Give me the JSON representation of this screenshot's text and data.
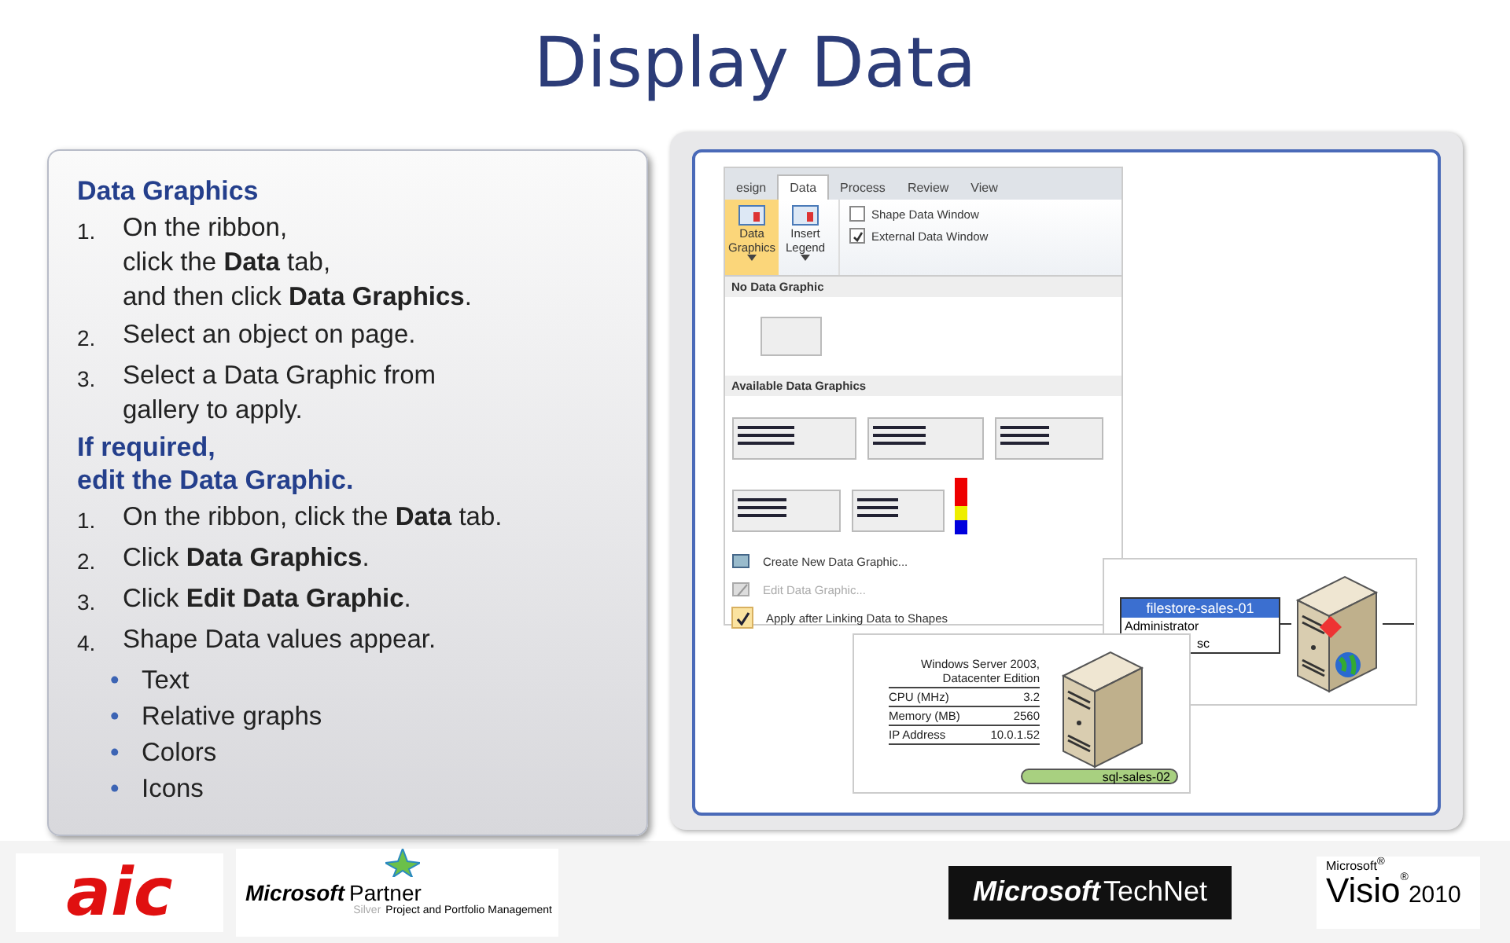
{
  "title": "Display Data",
  "instructions": [
    {
      "heading": "Data Graphics",
      "steps": [
        {
          "num": "1.",
          "text": "On the ribbon,\nclick the **Data** tab,\nand then click **Data Graphics**."
        },
        {
          "num": "2.",
          "text": "Select an object on page."
        },
        {
          "num": "3.",
          "text": "Select a Data Graphic from\ngallery to apply."
        }
      ]
    },
    {
      "heading": "If required,\nedit the Data Graphic.",
      "steps": [
        {
          "num": "1.",
          "text": "On the ribbon, click the **Data** tab."
        },
        {
          "num": "2.",
          "text": "Click **Data Graphics**."
        },
        {
          "num": "3.",
          "text": "Click **Edit Data Graphic**."
        },
        {
          "num": "4.",
          "text": "Shape Data values appear.",
          "bullets": [
            {
              "mark": "•",
              "text": "Text"
            },
            {
              "mark": "•",
              "text": "Relative graphs"
            },
            {
              "mark": "•",
              "text": "Colors"
            },
            {
              "mark": "•",
              "text": "Icons"
            }
          ]
        }
      ]
    }
  ],
  "screenshot": {
    "tabs": [
      {
        "label": "esign",
        "selected": false
      },
      {
        "label": "Data",
        "selected": true
      },
      {
        "label": "Process",
        "selected": false
      },
      {
        "label": "Review",
        "selected": false
      },
      {
        "label": "View",
        "selected": false
      }
    ],
    "ribbon_buttons": [
      {
        "label": "Data\nGraphics",
        "selected": true
      },
      {
        "label": "Insert\nLegend",
        "selected": false
      }
    ],
    "checkboxes": [
      {
        "label": "Shape Data Window",
        "checked": false
      },
      {
        "label": "External Data Window",
        "checked": true
      }
    ],
    "gallery_sections": [
      "No Data Graphic",
      "Available Data Graphics"
    ],
    "menu_items": [
      {
        "label": "Create New Data Graphic...",
        "kind": "create",
        "disabled": false
      },
      {
        "label": "Edit Data Graphic...",
        "kind": "edit",
        "disabled": true
      },
      {
        "label": "Apply after Linking Data to Shapes",
        "kind": "toggle",
        "disabled": false,
        "checked": true
      }
    ],
    "file_server": {
      "title": "filestore-sales-01",
      "rows": [
        "Administrator",
        "sc"
      ]
    },
    "sql_server": {
      "header": "Windows Server 2003,\nDatacenter Edition",
      "rows": [
        {
          "label": "CPU (MHz)",
          "value": "3.2"
        },
        {
          "label": "Memory (MB)",
          "value": "2560"
        },
        {
          "label": "IP Address",
          "value": "10.0.1.52"
        }
      ],
      "name": "sql-sales-02"
    }
  },
  "footer": {
    "aic": "aic",
    "partner_brand": "Microsoft",
    "partner": "Partner",
    "partner_level": "Silver",
    "partner_area": "Project and Portfolio Management",
    "technet_brand": "Microsoft",
    "technet": "TechNet",
    "visio_brand": "Microsoft$^{®}$",
    "visio": "Visio",
    "visio_mark": "®",
    "visio_year": "2010"
  }
}
